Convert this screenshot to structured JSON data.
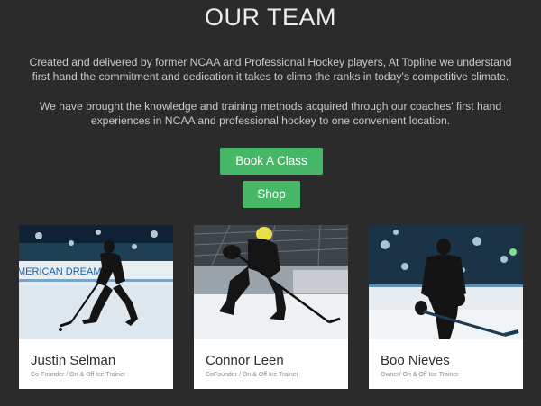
{
  "section": {
    "title": "OUR TEAM",
    "intro_1": "Created and delivered by former NCAA and Professional Hockey players, At Topline we understand first hand the commitment and dedication it takes to climb the ranks in today's competitive climate.",
    "intro_2": "We have brought the knowledge and training methods acquired through our coaches' first hand experiences in NCAA and professional hockey to one convenient location."
  },
  "buttons": {
    "book_label": "Book A Class",
    "shop_label": "Shop"
  },
  "team": [
    {
      "name": "Justin Selman",
      "role": "Co-Founder / On & Off Ice Trainer",
      "photo_text": "MERICAN DREAM"
    },
    {
      "name": "Connor Leen",
      "role": "CoFounder / On & Off Ice Trainer"
    },
    {
      "name": "Boo Nieves",
      "role": "Owner/ On & Off Ice Trainer"
    }
  ],
  "colors": {
    "background": "#2b2b2b",
    "button": "#45b766",
    "card": "#ffffff"
  }
}
